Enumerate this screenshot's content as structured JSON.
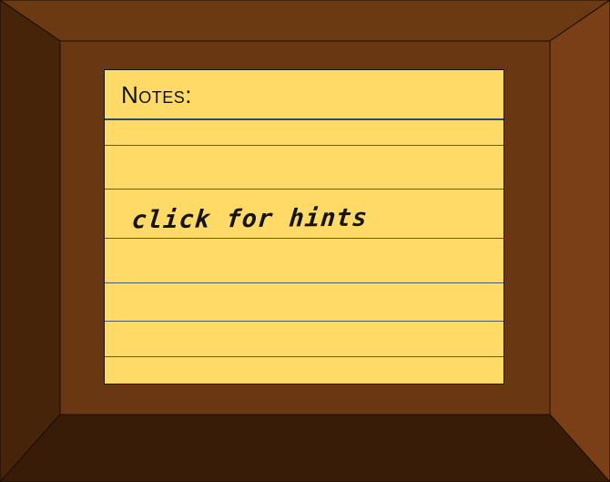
{
  "notes_card": {
    "title": "Notes:",
    "hint": "click for hints"
  },
  "colors": {
    "card_yellow": "#ffda66",
    "frame_top": "#6b3912",
    "frame_left": "#45240a",
    "frame_right": "#7a3f16",
    "frame_bottom": "#381c08",
    "frame_inner": "#693813",
    "title_rule": "#2c4a66",
    "line_rule": "#4b5868"
  }
}
